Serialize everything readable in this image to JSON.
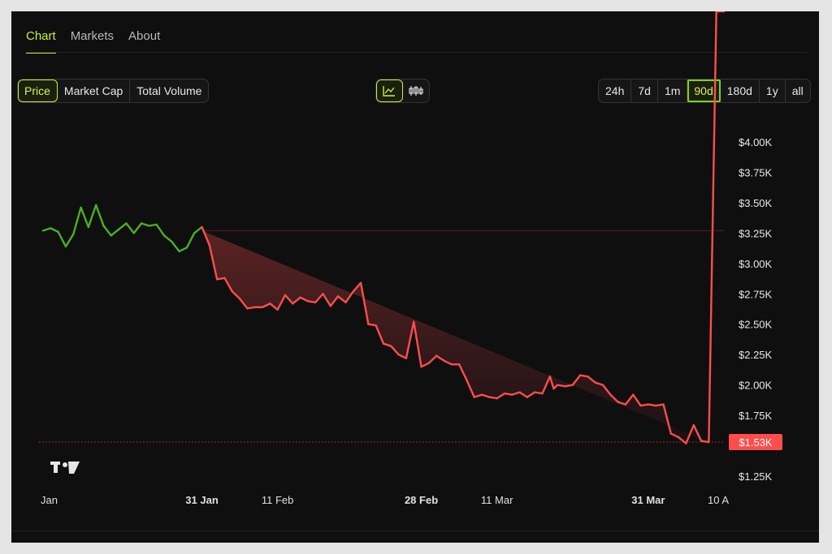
{
  "tabs": [
    "Chart",
    "Markets",
    "About"
  ],
  "metrics": [
    "Price",
    "Market Cap",
    "Total Volume"
  ],
  "chart_types": {
    "active": "line-chart-icon",
    "other": "candlestick-icon"
  },
  "ranges": [
    "24h",
    "7d",
    "1m",
    "90d",
    "180d",
    "1y",
    "all"
  ],
  "selected_range": "90d",
  "colors": {
    "accent": "#c9f135",
    "up": "#4caf20",
    "down": "#ff4d4d",
    "background": "#0f0f10"
  },
  "chart_data": {
    "type": "line",
    "title": "",
    "xlabel": "",
    "ylabel": "",
    "y_tick_labels": [
      "$4.00K",
      "$3.75K",
      "$3.50K",
      "$3.25K",
      "$3.00K",
      "$2.75K",
      "$2.50K",
      "$2.25K",
      "$2.00K",
      "$1.75K",
      "$1.25K"
    ],
    "ylim": [
      1250,
      4000
    ],
    "x_tick_labels": [
      "Jan",
      "31 Jan",
      "11 Feb",
      "28 Feb",
      "11 Mar",
      "31 Mar",
      "10 A"
    ],
    "x_tick_positions": [
      0,
      21,
      31,
      50,
      60,
      80,
      90
    ],
    "x_tick_bold": [
      false,
      true,
      false,
      true,
      false,
      true,
      false
    ],
    "reference_value": 3270,
    "current_price_label": "$1.53K",
    "current_price": 1530,
    "grid": false,
    "x": [
      0,
      1,
      2,
      3,
      4,
      5,
      6,
      7,
      8,
      9,
      10,
      11,
      12,
      13,
      14,
      15,
      16,
      17,
      18,
      19,
      20,
      21,
      22,
      23,
      24,
      25,
      26,
      27,
      28,
      29,
      30,
      31,
      32,
      33,
      34,
      35,
      36,
      37,
      38,
      39,
      40,
      41,
      42,
      43,
      44,
      45,
      46,
      47,
      48,
      49,
      50,
      51,
      52,
      53,
      54,
      55,
      56,
      57,
      58,
      59,
      60,
      61,
      62,
      63,
      64,
      65,
      66,
      67,
      67.5,
      68,
      69,
      70,
      71,
      72,
      73,
      74,
      75,
      76,
      77,
      78,
      79,
      80,
      81,
      82,
      83,
      84,
      85,
      86,
      87,
      88,
      89,
      90
    ],
    "values": [
      3270,
      3290,
      3260,
      3140,
      3240,
      3460,
      3300,
      3480,
      3310,
      3230,
      3280,
      3330,
      3250,
      3330,
      3310,
      3320,
      3230,
      3180,
      3100,
      3130,
      3250,
      3300,
      3150,
      2870,
      2880,
      2770,
      2710,
      2630,
      2640,
      2640,
      2670,
      2620,
      2740,
      2670,
      2720,
      2690,
      2680,
      2750,
      2650,
      2730,
      2680,
      2770,
      2840,
      2500,
      2490,
      2340,
      2320,
      2250,
      2220,
      2520,
      2150,
      2180,
      2240,
      2200,
      2170,
      2170,
      2040,
      1900,
      1920,
      1900,
      1890,
      1930,
      1920,
      1940,
      1900,
      1940,
      1930,
      2070,
      1970,
      2000,
      1990,
      2000,
      2080,
      2070,
      2020,
      2000,
      1920,
      1860,
      1840,
      1920,
      1830,
      1840,
      1830,
      1840,
      1600,
      1570,
      1520,
      1670,
      1540,
      1530
    ],
    "up_until_index": 21
  }
}
